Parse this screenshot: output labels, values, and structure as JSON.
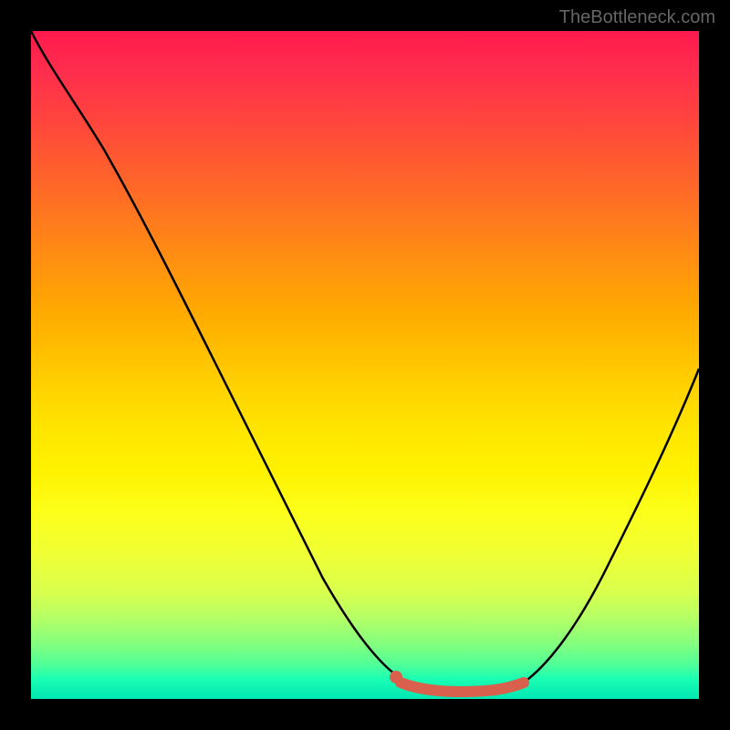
{
  "watermark": "TheBottleneck.com",
  "chart_data": {
    "type": "line",
    "title": "",
    "xlabel": "",
    "ylabel": "",
    "xlim": [
      0,
      100
    ],
    "ylim": [
      0,
      100
    ],
    "background_gradient": {
      "top_color": "#ff1a4d",
      "bottom_color": "#00e6b3",
      "description": "red-to-green vertical gradient indicating bottleneck severity"
    },
    "series": [
      {
        "name": "bottleneck-curve",
        "color": "#000000",
        "x": [
          0,
          5,
          10,
          15,
          20,
          25,
          30,
          35,
          40,
          45,
          50,
          54,
          58,
          62,
          66,
          70,
          74,
          78,
          82,
          86,
          90,
          95,
          100
        ],
        "y": [
          100,
          95,
          88,
          80,
          72,
          63,
          54,
          45,
          36,
          27,
          18,
          10,
          4,
          1,
          0,
          0,
          1,
          3,
          8,
          15,
          24,
          36,
          50
        ]
      },
      {
        "name": "highlight-band",
        "color": "#d9604d",
        "type": "band",
        "x": [
          54,
          74
        ],
        "y": [
          1,
          1
        ],
        "description": "coral highlight segment near curve minimum"
      },
      {
        "name": "highlight-dot",
        "color": "#d9604d",
        "type": "point",
        "x": [
          54
        ],
        "y": [
          2
        ]
      }
    ]
  }
}
